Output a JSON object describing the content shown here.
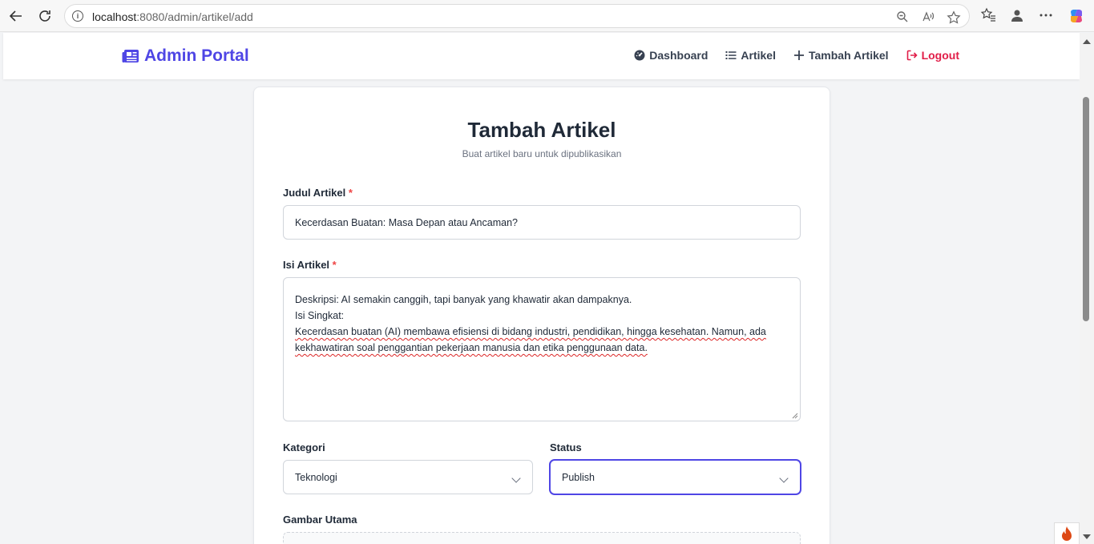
{
  "browser": {
    "url_host": "localhost",
    "url_path": ":8080/admin/artikel/add"
  },
  "navbar": {
    "brand": "Admin Portal",
    "links": [
      {
        "label": "Dashboard",
        "icon": "dashboard-icon"
      },
      {
        "label": "Artikel",
        "icon": "list-icon"
      },
      {
        "label": "Tambah Artikel",
        "icon": "plus-icon"
      },
      {
        "label": "Logout",
        "icon": "logout-icon"
      }
    ]
  },
  "form": {
    "title": "Tambah Artikel",
    "subtitle": "Buat artikel baru untuk dipublikasikan",
    "judul_label": "Judul Artikel",
    "judul_value": "Kecerdasan Buatan: Masa Depan atau Ancaman?",
    "isi_label": "Isi Artikel",
    "isi_lines": [
      "Deskripsi: AI semakin canggih, tapi banyak yang khawatir akan dampaknya.",
      "Isi Singkat:",
      "Kecerdasan buatan (AI) membawa efisiensi di bidang industri, pendidikan, hingga kesehatan. Namun, ada",
      "kekhawatiran soal penggantian pekerjaan manusia dan etika penggunaan data."
    ],
    "required_mark": "*",
    "kategori_label": "Kategori",
    "kategori_value": "Teknologi",
    "status_label": "Status",
    "status_value": "Publish",
    "gambar_label": "Gambar Utama"
  },
  "colors": {
    "brand": "#4f46e5",
    "logout": "#e11d48",
    "required": "#ef4444"
  }
}
